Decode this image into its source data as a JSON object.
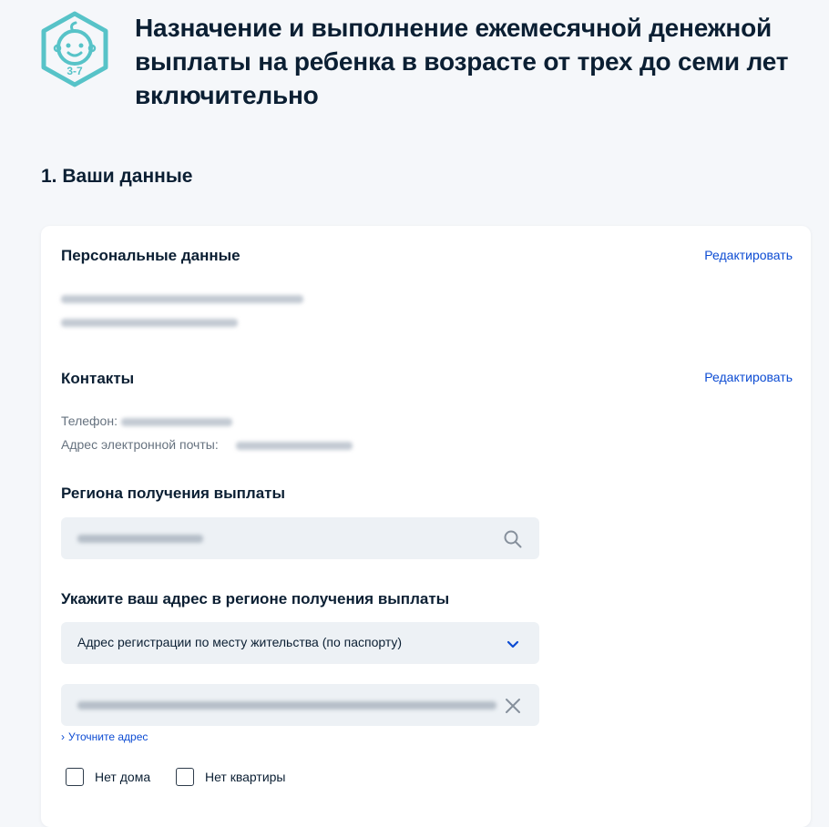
{
  "header": {
    "logo_label": "3-7",
    "title": "Назначение и выполнение ежемесячной денежной выплаты на ребенка в возрасте от трех до семи лет включительно"
  },
  "step": {
    "title": "1. Ваши данные"
  },
  "personal": {
    "title": "Персональные данные",
    "edit_label": "Редактировать"
  },
  "contacts": {
    "title": "Контакты",
    "edit_label": "Редактировать",
    "phone_label": "Телефон:",
    "email_label": "Адрес электронной почты:"
  },
  "region": {
    "title": "Региона получения выплаты"
  },
  "address": {
    "title": "Укажите ваш адрес в регионе получения выплаты",
    "select_value": "Адрес регистрации по месту жительства (по паспорту)",
    "clarify_link": "Уточните адрес",
    "no_house_label": "Нет дома",
    "no_flat_label": "Нет квартиры"
  },
  "colors": {
    "accent": "#0d4cd3",
    "logo_teal": "#57c3c8",
    "input_bg": "#edf1f5"
  }
}
